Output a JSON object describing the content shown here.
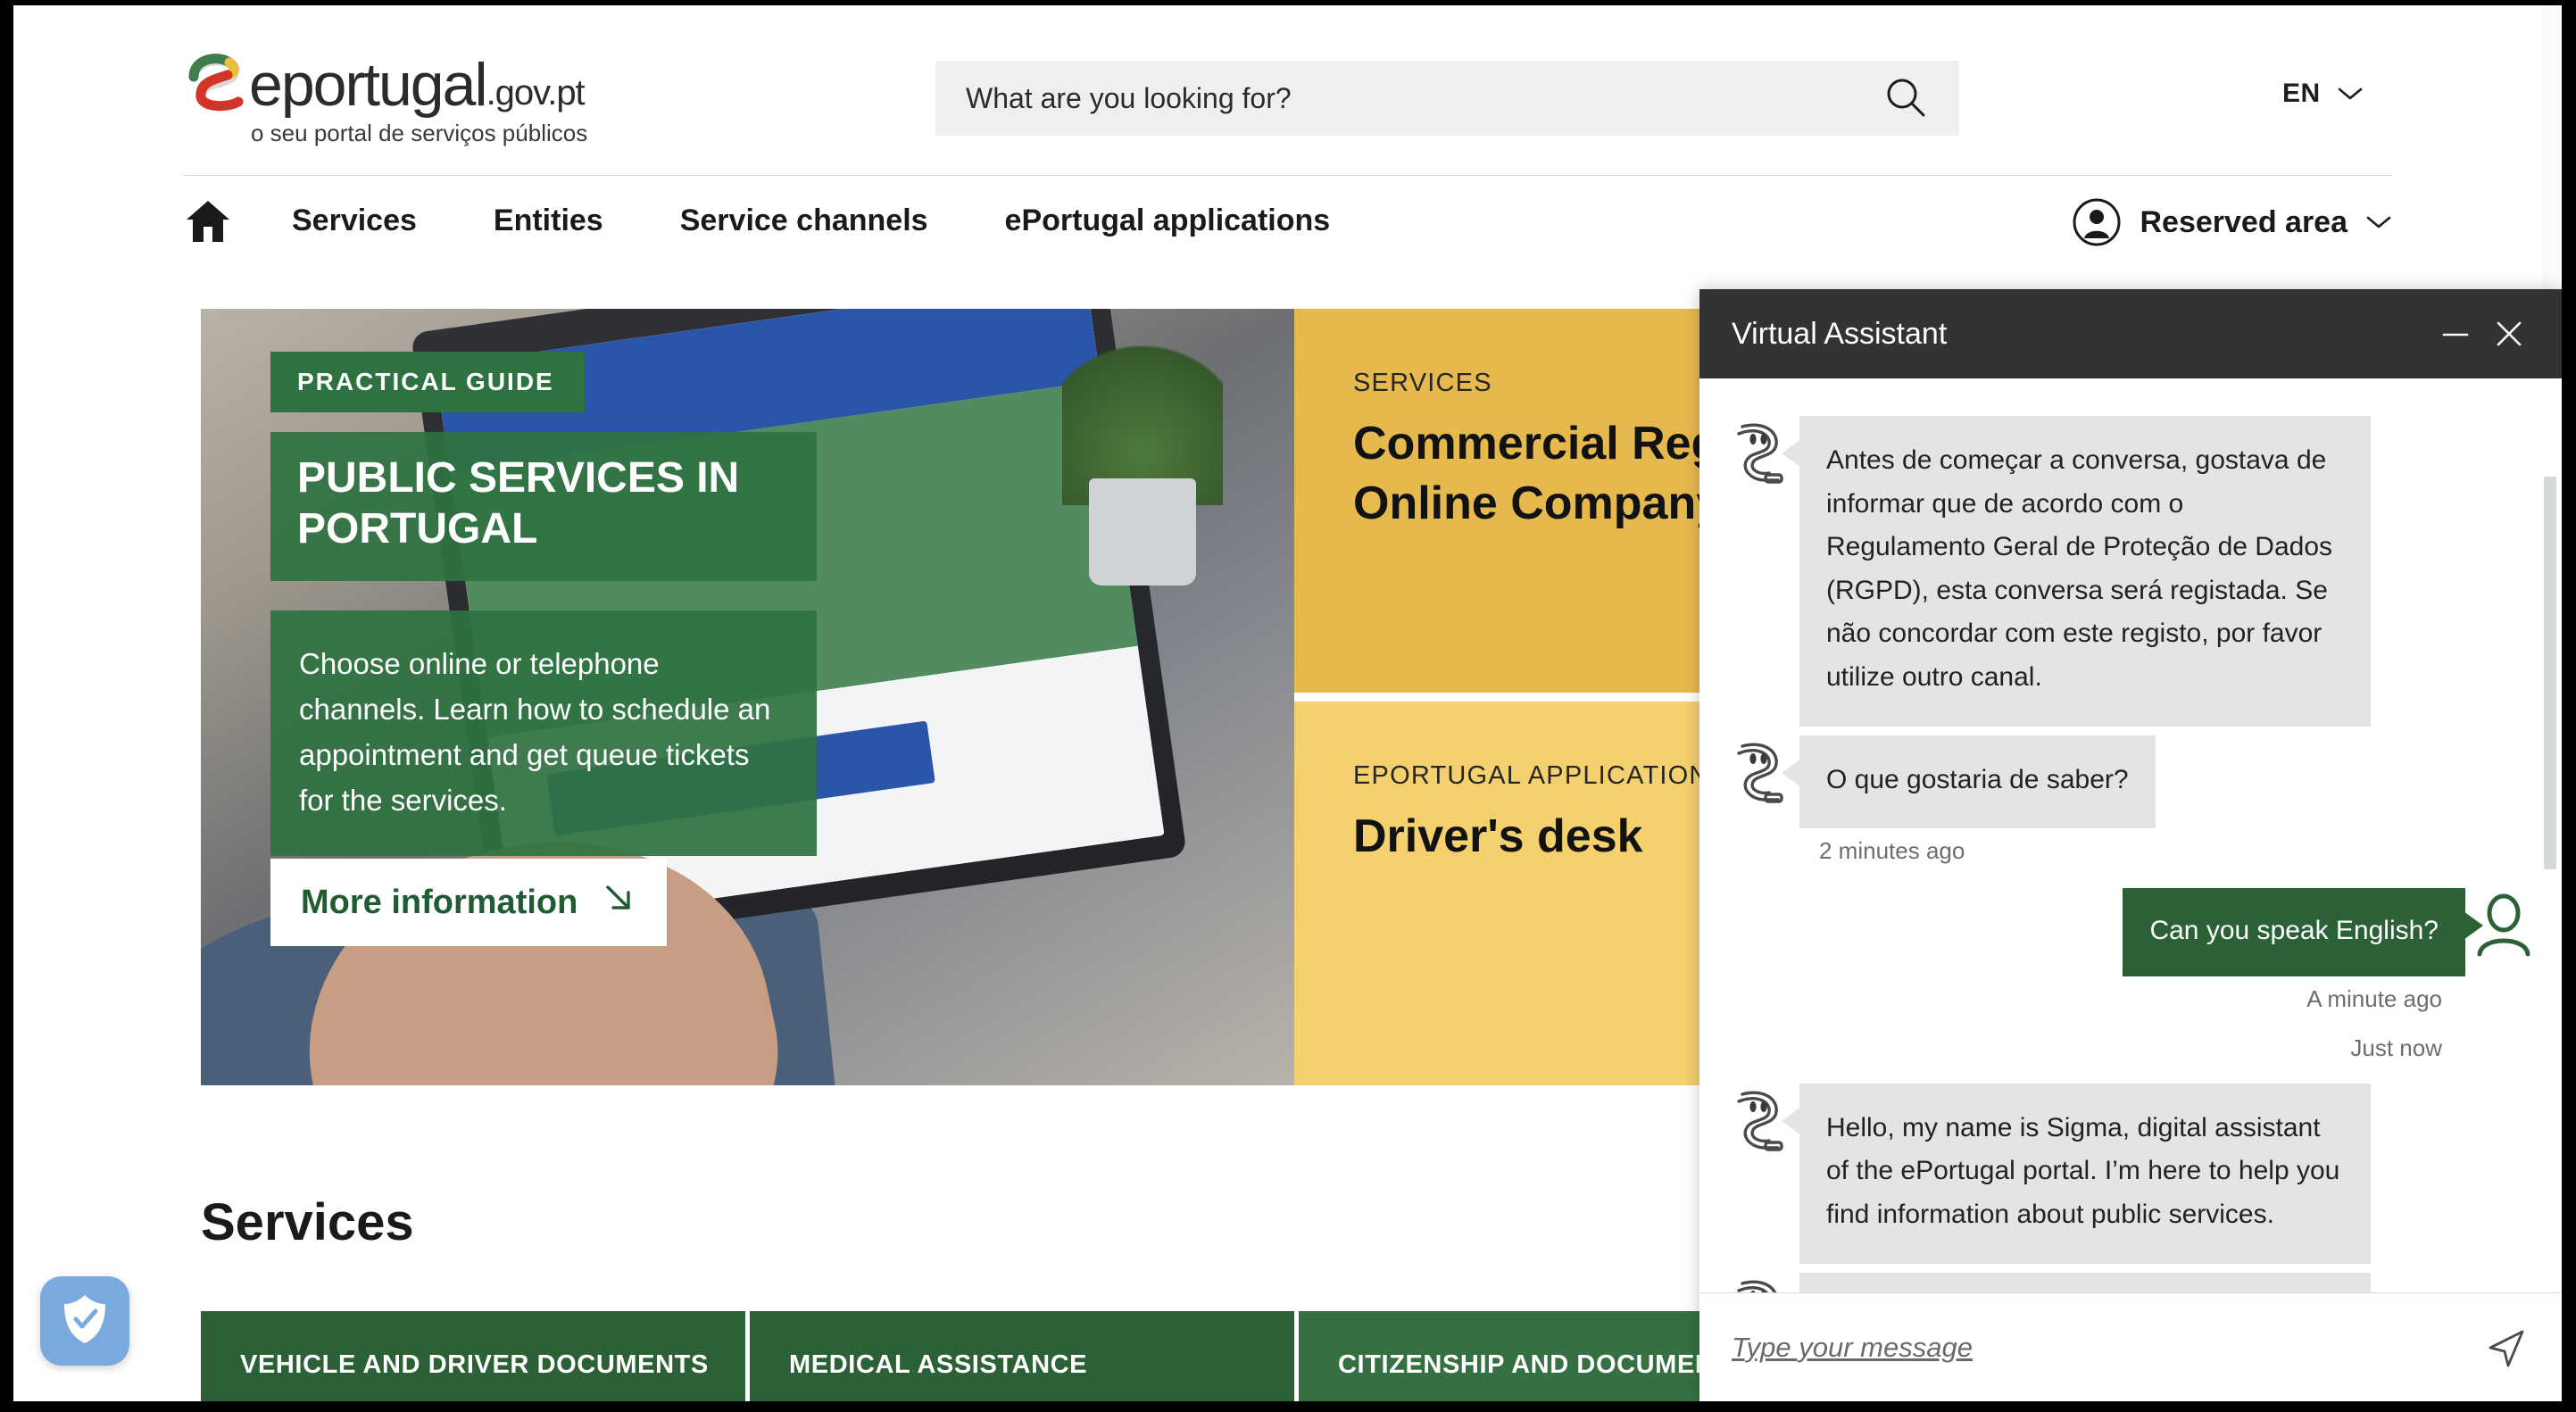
{
  "header": {
    "logo": {
      "brand": "eportugal",
      "tld": ".gov.pt",
      "tagline": "o seu portal de serviços públicos"
    },
    "search": {
      "placeholder": "What are you looking for?",
      "value": "",
      "icon": "search-icon"
    },
    "language": {
      "label": "EN",
      "icon": "chevron-down-icon"
    }
  },
  "nav": {
    "home_icon": "home-icon",
    "items": [
      {
        "label": "Services"
      },
      {
        "label": "Entities"
      },
      {
        "label": "Service channels"
      },
      {
        "label": "ePortugal applications"
      }
    ],
    "reserved_area": {
      "label": "Reserved area",
      "icon": "user-circle-icon",
      "chevron": "chevron-down-icon"
    }
  },
  "hero": {
    "tag": "PRACTICAL GUIDE",
    "title": "PUBLIC SERVICES IN PORTUGAL",
    "body": "Choose online or telephone channels. Learn how to schedule an appointment and get queue tickets for the services.",
    "button": {
      "label": "More information",
      "icon": "arrow-down-right-icon"
    },
    "cards": [
      {
        "kicker": "SERVICES",
        "title": "Commercial Registry | Online Company",
        "icon": "globe-building-icon",
        "arrow": "arrow-down-right-icon",
        "color": "#e5b94e"
      },
      {
        "kicker": "EPORTUGAL APPLICATION",
        "title": "Driver's desk",
        "icon": "car-icon",
        "arrow": "arrow-down-right-icon",
        "color": "#f4d06f"
      }
    ]
  },
  "services_section": {
    "heading": "Services",
    "tiles": [
      {
        "label": "VEHICLE AND DRIVER DOCUMENTS"
      },
      {
        "label": "MEDICAL ASSISTANCE"
      },
      {
        "label": "CITIZENSHIP AND DOCUMENTS"
      }
    ]
  },
  "security_badge": {
    "icon": "shield-check-icon",
    "color": "#7aaadd"
  },
  "chat": {
    "title": "Virtual Assistant",
    "minimize_icon": "minimize-icon",
    "close_icon": "close-icon",
    "messages": [
      {
        "sender": "bot",
        "avatar": "robot-avatar-icon",
        "text": "Antes de começar a conversa, gostava de informar que de acordo com o Regulamento Geral de Proteção de Dados (RGPD), esta conversa será registada. Se não concordar com este registo, por favor utilize outro canal."
      },
      {
        "sender": "bot",
        "avatar": "robot-avatar-icon",
        "text": "O que gostaria de saber?",
        "timestamp": "2 minutes ago"
      },
      {
        "sender": "user",
        "avatar": "user-avatar-icon",
        "text": "Can you speak English?",
        "timestamp": "A minute ago",
        "timestamp2": "Just now"
      },
      {
        "sender": "bot",
        "avatar": "robot-avatar-icon",
        "text": "Hello, my name is Sigma, digital assistant of the ePortugal portal. I’m here to help you find information about public services."
      },
      {
        "sender": "bot",
        "avatar": "robot-avatar-icon",
        "text": ""
      }
    ],
    "input": {
      "placeholder": "Type your message",
      "value": ""
    },
    "send_icon": "send-icon"
  }
}
